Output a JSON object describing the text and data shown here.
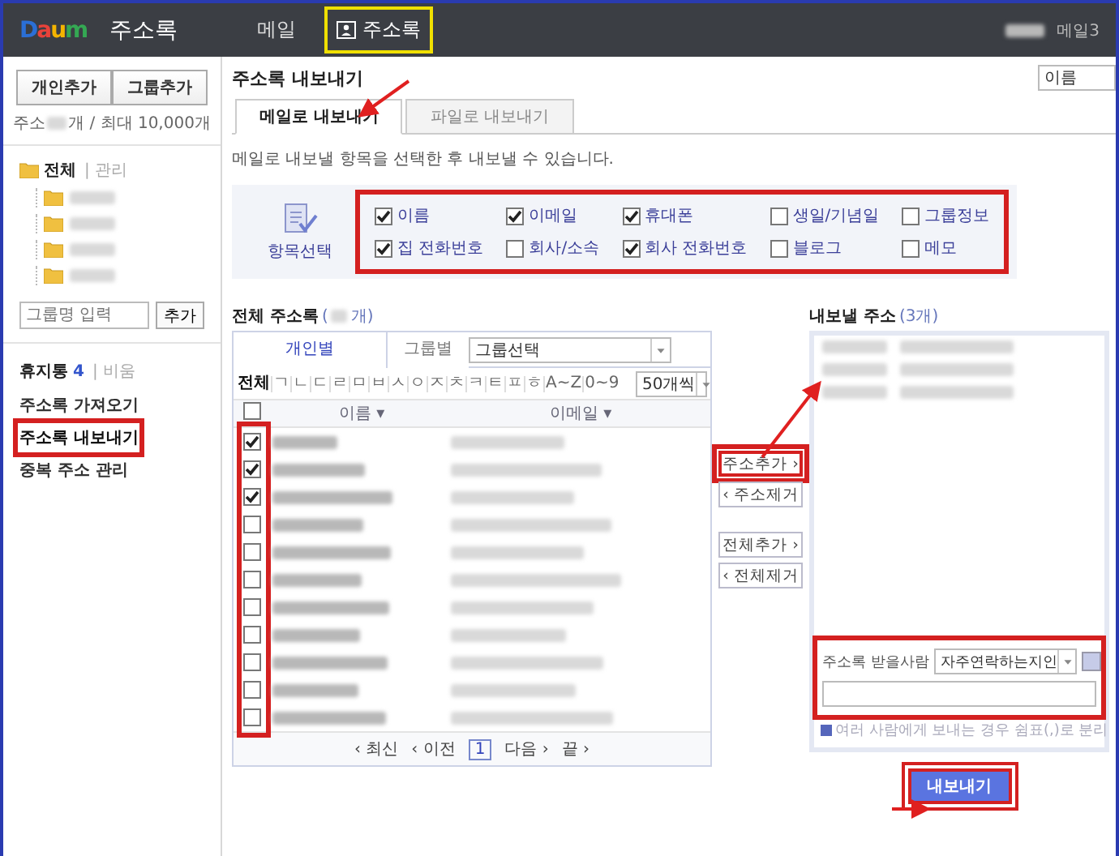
{
  "header": {
    "logo": "Daum",
    "app_name": "주소록",
    "user_menu": "메일3",
    "nav": [
      {
        "label": "메일",
        "selected": false,
        "highlighted": false
      },
      {
        "label": "주소록",
        "selected": true,
        "highlighted": true
      }
    ]
  },
  "sidebar": {
    "add_buttons": [
      "개인추가",
      "그룹추가"
    ],
    "quota": {
      "prefix": "주소",
      "suffix": "개 / 최대 10,000개"
    },
    "tree": {
      "label": "전체",
      "action": "| 관리",
      "children": [
        {
          "kind": "redacted"
        },
        {
          "kind": "redacted"
        },
        {
          "kind": "redacted"
        },
        {
          "kind": "redacted"
        }
      ]
    },
    "group_input": {
      "placeholder": "그룹명 입력"
    },
    "add_group_button": "추가",
    "trash": {
      "label": "휴지통",
      "count": "4",
      "action": "| 비움"
    },
    "links": [
      {
        "label": "주소록 가져오기",
        "selected": false,
        "highlighted": false
      },
      {
        "label": "주소록 내보내기",
        "selected": true,
        "highlighted": true
      },
      {
        "label": "중복 주소 관리",
        "selected": false,
        "highlighted": false
      }
    ]
  },
  "main": {
    "title": "주소록 내보내기",
    "sort_select": "이름",
    "tabs": [
      {
        "label": "메일로 내보내기",
        "selected": true
      },
      {
        "label": "파일로 내보내기",
        "selected": false
      }
    ],
    "description": "메일로 내보낼 항목을 선택한 후 내보낼 수 있습니다.",
    "fields_panel": {
      "label": "항목선택",
      "highlighted": true,
      "options": [
        {
          "label": "이름",
          "checked": true
        },
        {
          "label": "이메일",
          "checked": true
        },
        {
          "label": "휴대폰",
          "checked": true
        },
        {
          "label": "생일/기념일",
          "checked": false
        },
        {
          "label": "그룹정보",
          "checked": false
        },
        {
          "label": "집 전화번호",
          "checked": true
        },
        {
          "label": "회사/소속",
          "checked": false
        },
        {
          "label": "회사 전화번호",
          "checked": true
        },
        {
          "label": "블로그",
          "checked": false
        },
        {
          "label": "메모",
          "checked": false
        }
      ]
    }
  },
  "address_book": {
    "title": "전체 주소록",
    "count_prefix": "(",
    "count_suffix": "개)",
    "view_tabs": [
      {
        "label": "개인별",
        "selected": true
      },
      {
        "label": "그룹별",
        "selected": false
      }
    ],
    "group_select": "그룹선택",
    "initials": [
      "전체",
      "ㄱ",
      "ㄴ",
      "ㄷ",
      "ㄹ",
      "ㅁ",
      "ㅂ",
      "ㅅ",
      "ㅇ",
      "ㅈ",
      "ㅊ",
      "ㅋ",
      "ㅌ",
      "ㅍ",
      "ㅎ",
      "A~Z",
      "0~9"
    ],
    "page_size": "50개씩",
    "columns": [
      "이름 ▾",
      "이메일 ▾"
    ],
    "select_all": {
      "checked": false
    },
    "checkbox_column_highlighted": true,
    "rows": [
      {
        "kind": "redacted",
        "checked": true
      },
      {
        "kind": "redacted",
        "checked": true
      },
      {
        "kind": "redacted",
        "checked": true
      },
      {
        "kind": "redacted",
        "checked": false
      },
      {
        "kind": "redacted",
        "checked": false
      },
      {
        "kind": "redacted",
        "checked": false
      },
      {
        "kind": "redacted",
        "checked": false
      },
      {
        "kind": "redacted",
        "checked": false
      },
      {
        "kind": "redacted",
        "checked": false
      },
      {
        "kind": "redacted",
        "checked": false
      },
      {
        "kind": "redacted",
        "checked": false
      }
    ],
    "pagination": {
      "first": "‹ 최신",
      "prev": "‹ 이전",
      "pages": [
        {
          "label": "1",
          "selected": true
        }
      ],
      "next": "다음 ›",
      "last": "끝 ›"
    }
  },
  "transfer_buttons": [
    {
      "label": "주소추가 ›",
      "highlighted": true
    },
    {
      "label": "‹ 주소제거",
      "highlighted": false
    },
    {
      "label": "전체추가 ›",
      "highlighted": false
    },
    {
      "label": "‹ 전체제거",
      "highlighted": false
    }
  ],
  "export_list": {
    "title": "내보낼 주소",
    "count": "(3개)",
    "rows": [
      {
        "kind": "redacted"
      },
      {
        "kind": "redacted"
      },
      {
        "kind": "redacted"
      }
    ],
    "recipient": {
      "label": "주소록 받을사람",
      "select": "자주연락하는지인",
      "highlighted": true
    },
    "hint": "여러 사람에게 보내는 경우 쉼표(,)로 분리"
  },
  "submit": {
    "label": "내보내기",
    "highlighted": true
  }
}
